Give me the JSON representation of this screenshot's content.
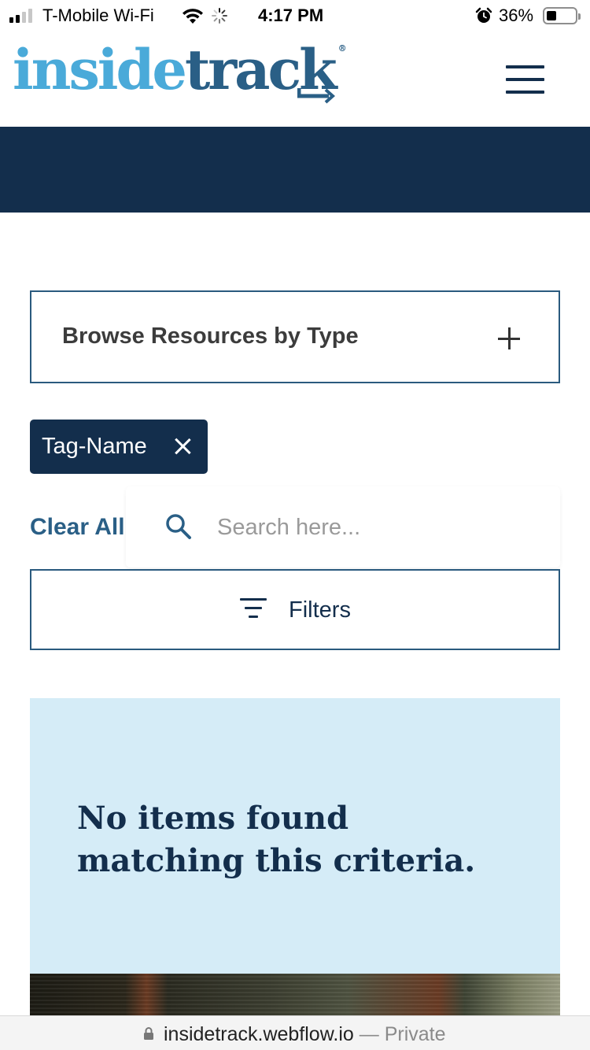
{
  "status_bar": {
    "carrier": "T-Mobile Wi-Fi",
    "time": "4:17 PM",
    "battery_percent": "36%",
    "battery_level": 0.36,
    "signal_bars": 2,
    "signal_bars_total": 4,
    "icons": [
      "signal-icon",
      "wifi-icon",
      "activity-spinner-icon",
      "alarm-icon",
      "battery-icon"
    ]
  },
  "header": {
    "logo_light": "inside",
    "logo_dark": "track",
    "logo_mark": "®",
    "menu_icon": "hamburger-menu-icon"
  },
  "browse": {
    "label": "Browse Resources by Type",
    "icon": "plus-icon"
  },
  "active_tag": {
    "label": "Tag-Name",
    "icon": "close-icon"
  },
  "clear_all": "Clear All",
  "search": {
    "placeholder": "Search here...",
    "value": "",
    "icon": "search-icon"
  },
  "filters": {
    "label": "Filters",
    "icon": "filter-icon"
  },
  "empty_state": {
    "message": "No items found matching this criteria."
  },
  "url_bar": {
    "url": "insidetrack.webflow.io",
    "separator": "—",
    "mode": "Private",
    "icon": "lock-icon"
  },
  "colors": {
    "navy": "#132e4c",
    "brand_light_blue": "#4aaad9",
    "brand_dark_blue": "#2a5f86",
    "panel_blue": "#d5ecf7"
  }
}
